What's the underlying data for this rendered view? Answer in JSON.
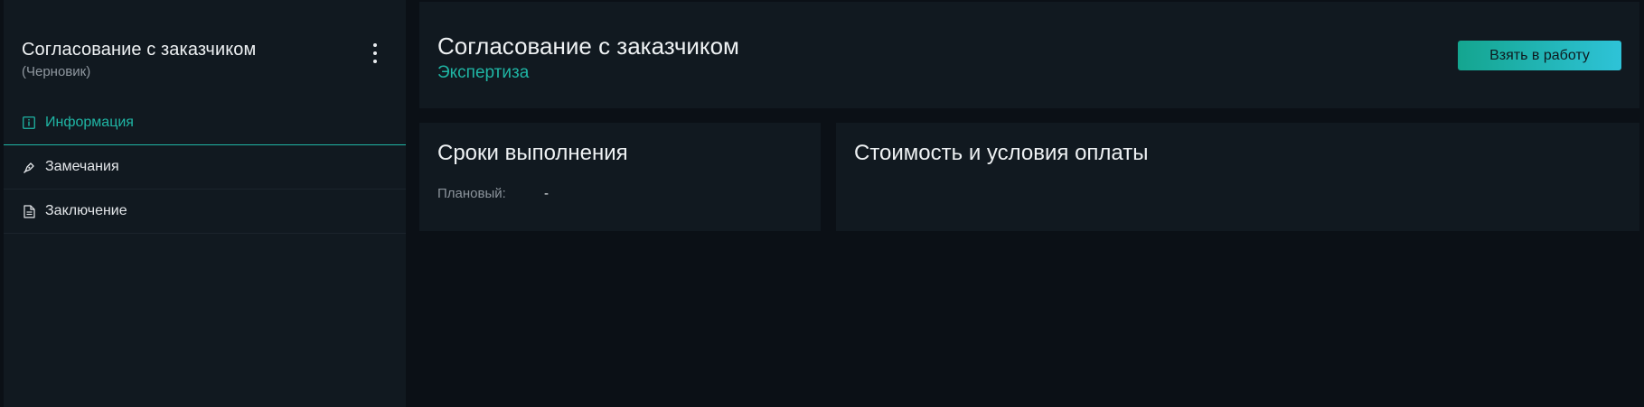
{
  "sidebar": {
    "title": "Согласование с заказчиком",
    "subtitle": "(Черновик)",
    "items": [
      {
        "label": "Информация",
        "icon": "info-icon",
        "active": true
      },
      {
        "label": "Замечания",
        "icon": "pen-icon",
        "active": false
      },
      {
        "label": "Заключение",
        "icon": "document-icon",
        "active": false
      }
    ]
  },
  "header": {
    "title": "Согласование с заказчиком",
    "subtitle": "Экспертиза",
    "action_label": "Взять в работу"
  },
  "cards": {
    "deadlines": {
      "title": "Сроки выполнения",
      "planned_label": "Плановый:",
      "planned_value": "-"
    },
    "cost": {
      "title": "Стоимость и условия оплаты"
    }
  },
  "colors": {
    "accent": "#1fb5a4",
    "panel": "#111920",
    "background": "#0b1016"
  }
}
